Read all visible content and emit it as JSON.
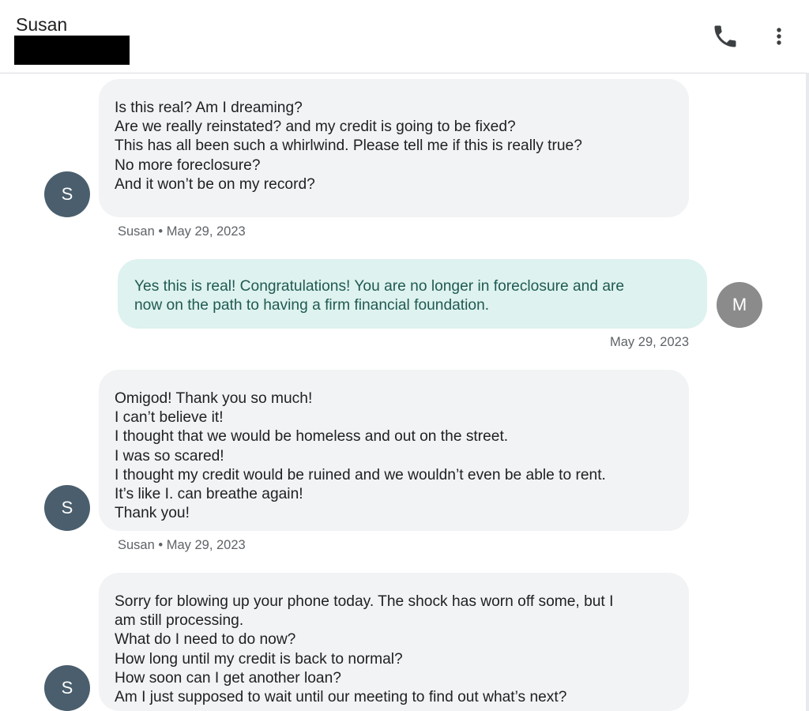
{
  "header": {
    "contact_name": "Susan",
    "call_icon": "phone-icon",
    "more_icon": "more-vert-icon"
  },
  "colors": {
    "incoming_bubble": "#f1f3f4",
    "outgoing_bubble": "#def2ef",
    "outgoing_text": "#1f5a52",
    "contact_avatar": "#4a5e6d",
    "self_avatar": "#8b8b8b"
  },
  "messages": [
    {
      "direction": "incoming",
      "avatar_letter": "S",
      "lines": [
        "Is this real? Am I dreaming?",
        "Are we really reinstated? and my credit is going to be fixed?",
        "This has all been such a whirlwind. Please tell me if this is really true?",
        "No more foreclosure?",
        "And it won’t be on my record?"
      ],
      "meta": "Susan • May 29, 2023"
    },
    {
      "direction": "outgoing",
      "avatar_letter": "M",
      "lines": [
        "Yes this is real! Congratulations! You are no longer in foreclosure and are",
        "now on the path to having a firm financial foundation."
      ],
      "meta": "May 29, 2023"
    },
    {
      "direction": "incoming",
      "avatar_letter": "S",
      "lines": [
        "Omigod! Thank you so much!",
        "I can’t believe it!",
        "I thought that we would be homeless and out on the street.",
        "I was so scared!",
        "I thought my credit would be ruined and we wouldn’t even be able to rent.",
        "It’s like I. can breathe again!",
        "Thank you!"
      ],
      "meta": "Susan • May 29, 2023"
    },
    {
      "direction": "incoming",
      "avatar_letter": "S",
      "lines": [
        "Sorry for blowing up your phone today. The shock has worn off some, but I",
        "am still processing.",
        "What do I need to do now?",
        "How long until my credit is back to normal?",
        "How soon can I get another loan?",
        "Am I just supposed to wait until our meeting to find out what’s next?"
      ],
      "meta": ""
    }
  ]
}
